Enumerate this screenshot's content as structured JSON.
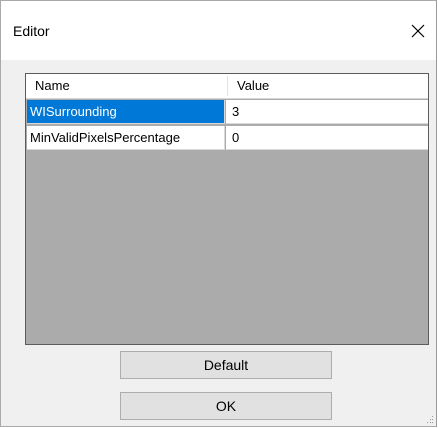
{
  "window": {
    "title": "Editor",
    "close_icon": "close-icon"
  },
  "grid": {
    "columns": [
      "Name",
      "Value"
    ],
    "rows": [
      {
        "name": "WISurrounding",
        "value": "3",
        "selected": true
      },
      {
        "name": "MinValidPixelsPercentage",
        "value": "0",
        "selected": false
      }
    ],
    "empty_area_color": "#ababab",
    "selection_color": "#0078d7"
  },
  "buttons": {
    "default_label": "Default",
    "ok_label": "OK"
  }
}
